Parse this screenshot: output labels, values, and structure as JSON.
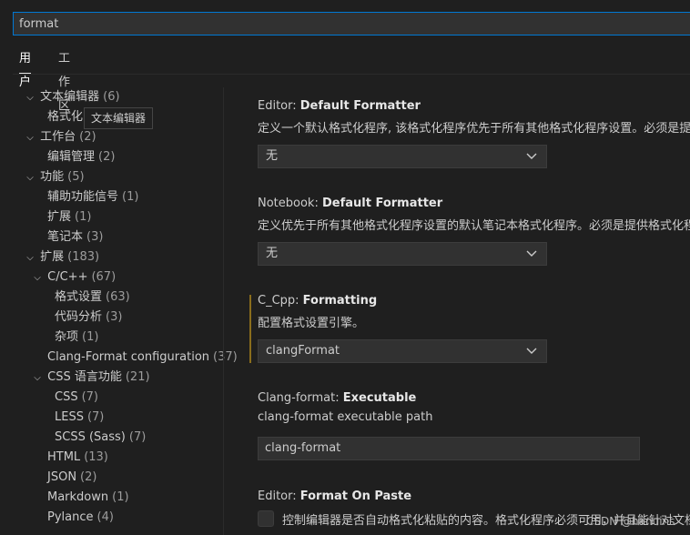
{
  "search": {
    "value": "format"
  },
  "tabs": [
    {
      "label": "用户"
    },
    {
      "label": "工作区"
    }
  ],
  "toc": {
    "items": [
      {
        "label": "文本编辑器",
        "count": "(6)"
      },
      {
        "label": "格式化"
      },
      {
        "label": "工作台",
        "count": "(2)"
      },
      {
        "label": "编辑管理",
        "count": "(2)"
      },
      {
        "label": "功能",
        "count": "(5)"
      },
      {
        "label": "辅助功能信号",
        "count": "(1)"
      },
      {
        "label": "扩展",
        "count": "(1)"
      },
      {
        "label": "笔记本",
        "count": "(3)"
      },
      {
        "label": "扩展",
        "count": "(183)"
      },
      {
        "label": "C/C++",
        "count": "(67)"
      },
      {
        "label": "格式设置",
        "count": "(63)"
      },
      {
        "label": "代码分析",
        "count": "(3)"
      },
      {
        "label": "杂项",
        "count": "(1)"
      },
      {
        "label": "Clang-Format configuration",
        "count": "(37)"
      },
      {
        "label": "CSS 语言功能",
        "count": "(21)"
      },
      {
        "label": "CSS",
        "count": "(7)"
      },
      {
        "label": "LESS",
        "count": "(7)"
      },
      {
        "label": "SCSS (Sass)",
        "count": "(7)"
      },
      {
        "label": "HTML",
        "count": "(13)"
      },
      {
        "label": "JSON",
        "count": "(2)"
      },
      {
        "label": "Markdown",
        "count": "(1)"
      },
      {
        "label": "Pylance",
        "count": "(4)"
      }
    ]
  },
  "tooltip": {
    "text": "文本编辑器"
  },
  "settings": {
    "editor_default_formatter": {
      "category": "Editor: ",
      "name": "Default Formatter",
      "description": "定义一个默认格式化程序, 该格式化程序优先于所有其他格式化程序设置。必须是提供格式化程序的扩展的标识符。",
      "value": "无"
    },
    "notebook_default_formatter": {
      "category": "Notebook: ",
      "name": "Default Formatter",
      "description": "定义优先于所有其他格式化程序设置的默认笔记本格式化程序。必须是提供格式化程序的扩展的标识符。",
      "value": "无"
    },
    "cpp_formatting": {
      "category": "C_Cpp: ",
      "name": "Formatting",
      "description": "配置格式设置引擎。",
      "value": "clangFormat"
    },
    "clang_format_executable": {
      "category": "Clang-format: ",
      "name": "Executable",
      "description": "clang-format executable path",
      "value": "clang-format"
    },
    "editor_format_on_paste": {
      "category": "Editor: ",
      "name": "Format On Paste",
      "description": "控制编辑器是否自动格式化粘贴的内容。格式化程序必须可用，并且能针对文档中的某一范围进行格式化。"
    }
  },
  "watermark": {
    "text": "CSDN @hanuins"
  },
  "colors": {
    "accent": "#0078d4",
    "modified": "#8a6d1c",
    "background": "#1f1f1f"
  }
}
